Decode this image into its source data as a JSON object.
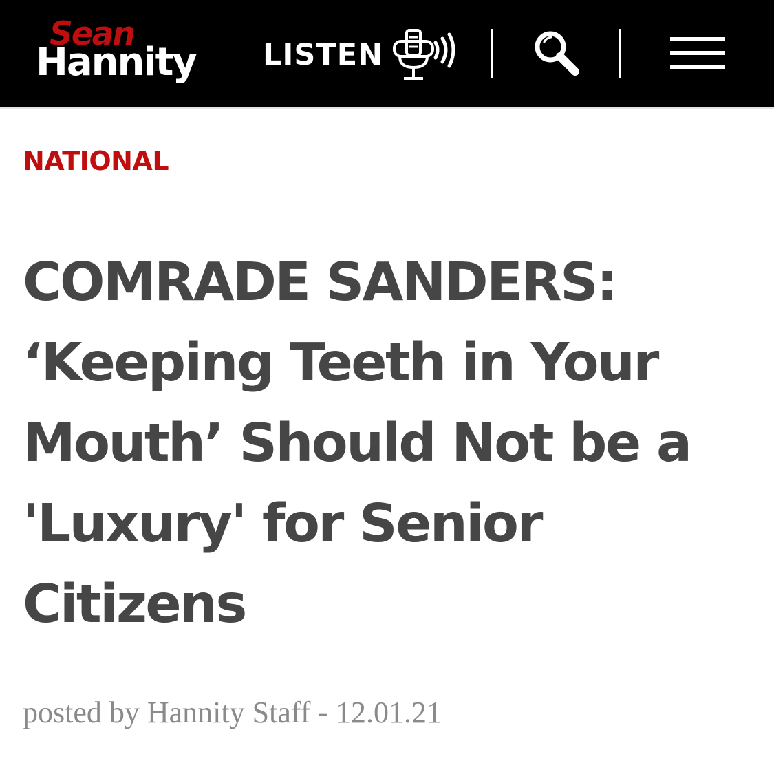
{
  "header": {
    "logo": {
      "line1": "Sean",
      "line2": "Hannity"
    },
    "listen_label": "LISTEN",
    "icons": {
      "listen": "microphone-broadcast-icon",
      "search": "search-icon",
      "menu": "hamburger-menu-icon"
    }
  },
  "article": {
    "category": "NATIONAL",
    "headline": "COMRADE SANDERS: ‘Keeping Teeth in Your Mouth’ Should Not be a 'Luxury' for Senior Citizens",
    "byline": "posted by Hannity Staff - 12.01.21"
  },
  "colors": {
    "header_bg": "#000000",
    "brand_red": "#c00e0e",
    "headline_text": "#464646",
    "byline_text": "#8a8a8a"
  }
}
